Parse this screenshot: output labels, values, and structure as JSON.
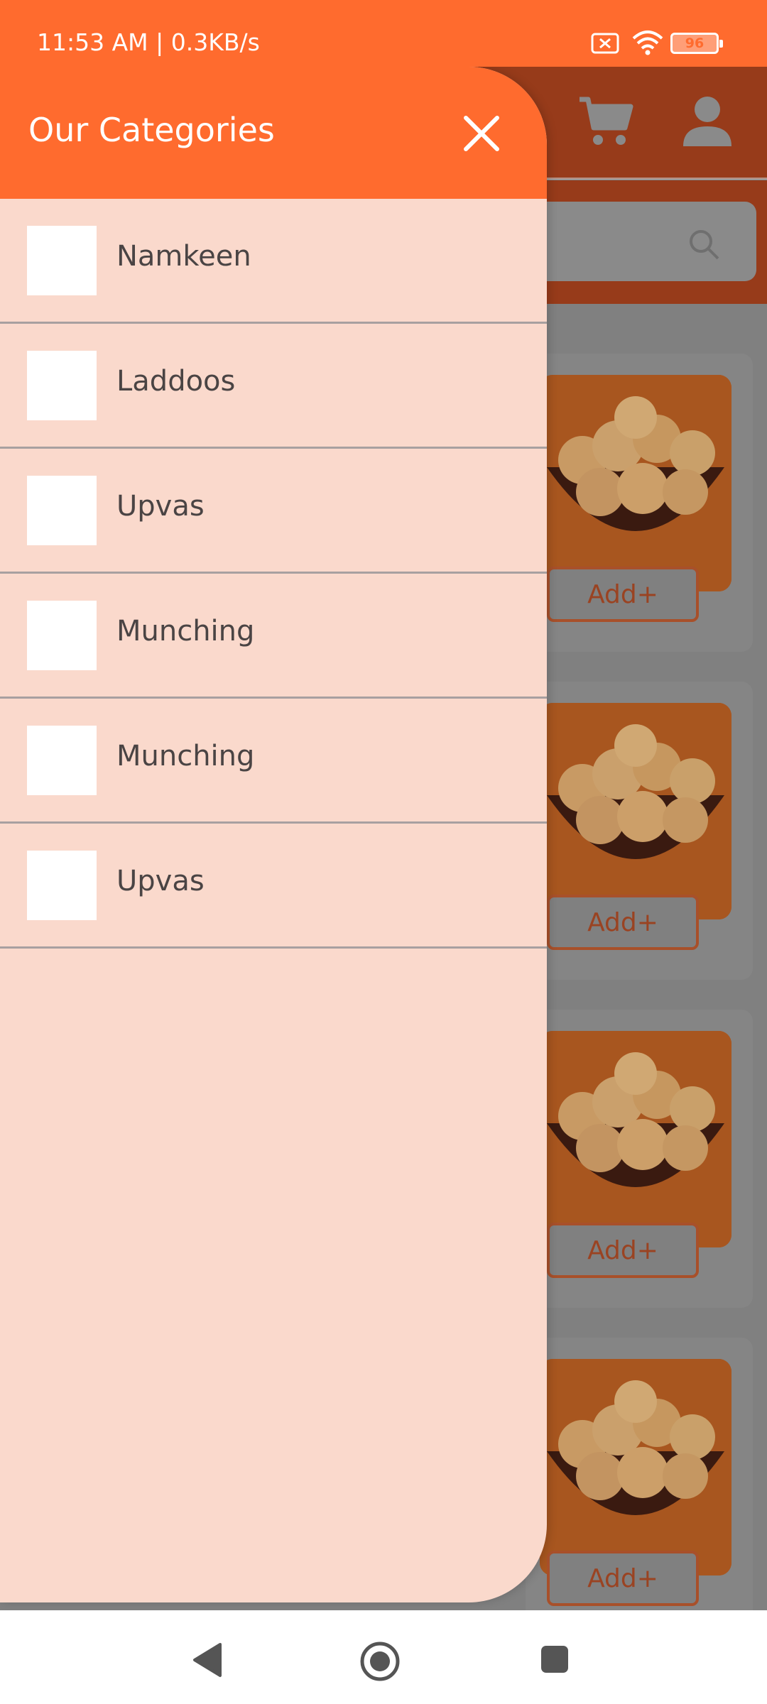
{
  "status_bar": {
    "time": "11:53 AM | 0.3KB/s",
    "battery": "96"
  },
  "drawer": {
    "title": "Our Categories",
    "close_icon": "close-icon",
    "categories": [
      {
        "label": "Namkeen"
      },
      {
        "label": "Laddoos"
      },
      {
        "label": "Upvas"
      },
      {
        "label": "Munching"
      },
      {
        "label": "Munching"
      },
      {
        "label": "Upvas"
      }
    ]
  },
  "background_app": {
    "header_icons": [
      "cart-icon",
      "profile-icon",
      "search-icon"
    ],
    "products": [
      {
        "add_label": "Add+"
      },
      {
        "add_label": "Add+"
      },
      {
        "add_label": "Add+"
      },
      {
        "add_label": "Add+"
      }
    ]
  },
  "colors": {
    "accent": "#ff6b2e",
    "drawer_bg": "#fad9cc",
    "scrim": "#808080"
  },
  "nav_bar": {
    "icons": [
      "back-icon",
      "home-icon",
      "recents-icon"
    ]
  }
}
